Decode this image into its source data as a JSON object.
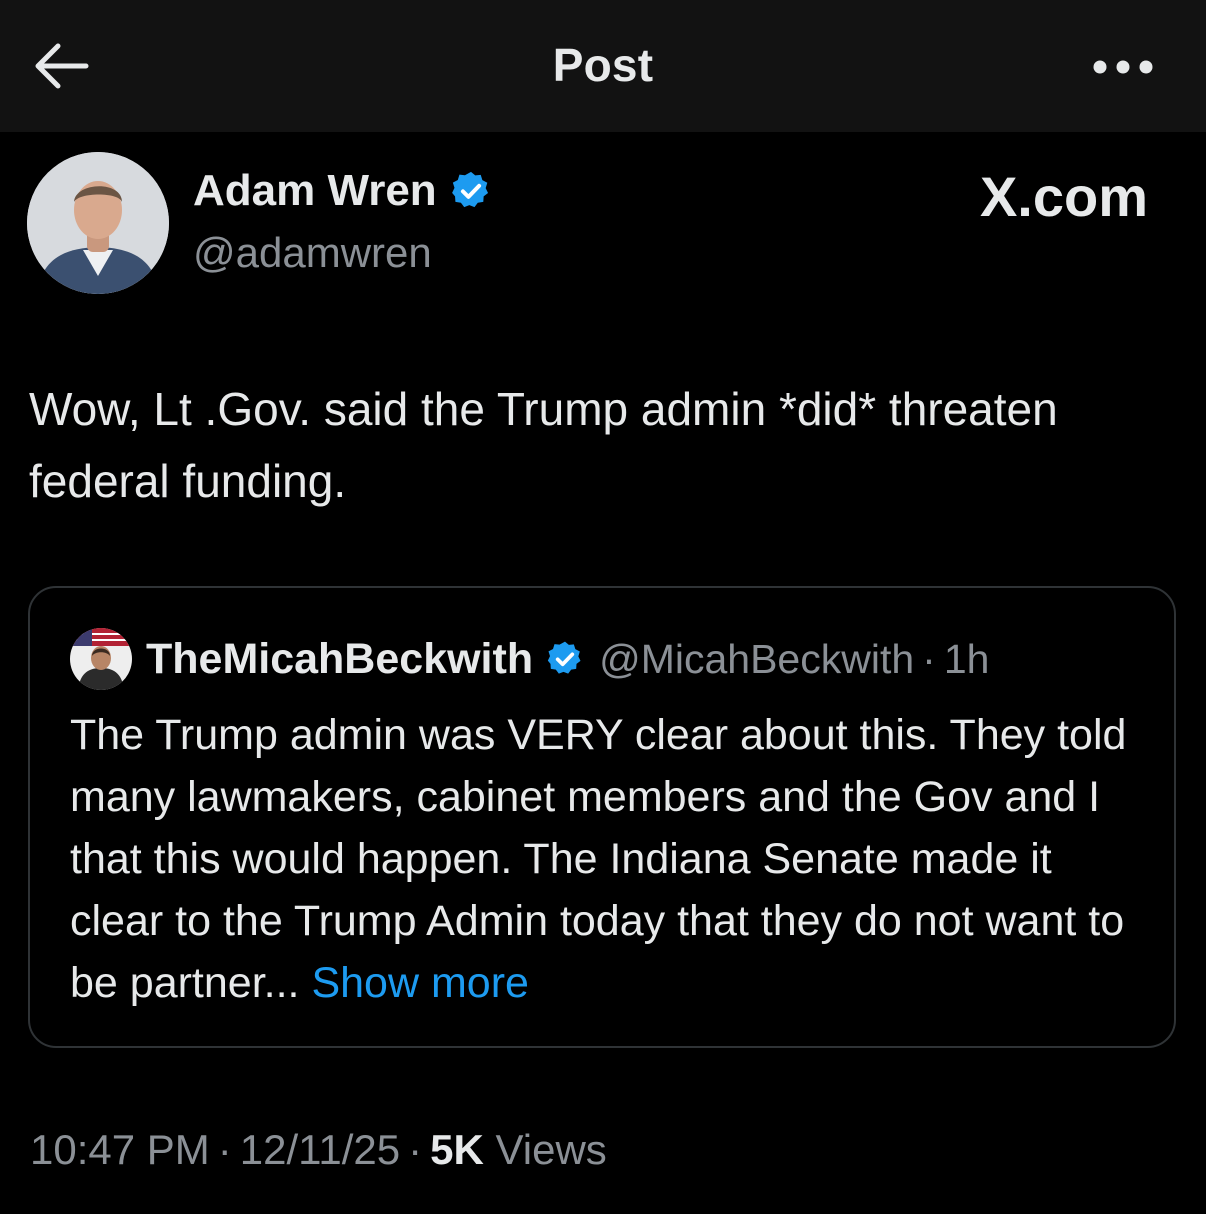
{
  "header": {
    "title": "Post",
    "back_icon": "arrow-left-icon",
    "more_icon": "more-horizontal-icon"
  },
  "post": {
    "author": {
      "name": "Adam Wren",
      "handle": "@adamwren",
      "verified": true
    },
    "source_label": "X.com",
    "text": "Wow, Lt .Gov. said the Trump admin *did* threaten federal funding.",
    "quoted": {
      "author_name": "TheMicahBeckwith",
      "handle": "@MicahBeckwith",
      "separator": "·",
      "time": "1h",
      "verified": true,
      "text": "The Trump admin was VERY clear about this. They told many lawmakers, cabinet members and the Gov and I that this would happen. The Indiana Senate made it clear to the Trump Admin today that they do not want to be partner...",
      "show_more_label": "Show more"
    },
    "meta": {
      "time": "10:47 PM",
      "separator": "·",
      "date": "12/11/25",
      "views_count": "5K",
      "views_label": "Views"
    }
  },
  "colors": {
    "background": "#000000",
    "topbar": "#121212",
    "text_primary": "#e7e9ea",
    "text_secondary": "#8b9096",
    "accent_blue": "#1d9bf0",
    "border": "#2f3336"
  }
}
